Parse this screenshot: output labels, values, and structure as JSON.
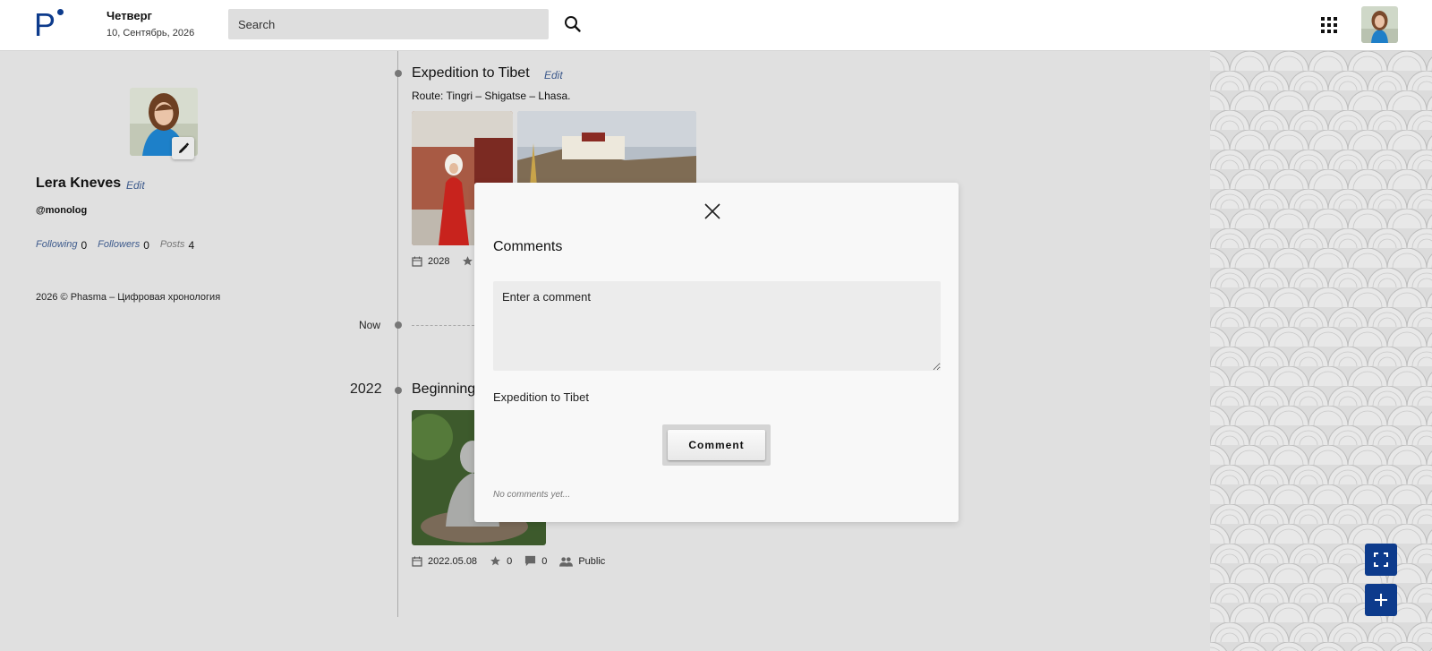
{
  "header": {
    "logo_letter": "P",
    "day_name": "Четверг",
    "date_full": "10, Сентябрь, 2026",
    "search_placeholder": "Search",
    "brand_color": "#0d3b8c"
  },
  "profile": {
    "name": "Lera Kneves",
    "edit_label": "Edit",
    "handle": "@monolog",
    "stats": [
      {
        "label": "Following",
        "value": "0"
      },
      {
        "label": "Followers",
        "value": "0"
      },
      {
        "label": "Posts",
        "value": "4"
      }
    ],
    "footer": "2026 © Phasma – Цифровая хронология"
  },
  "timeline": {
    "posts": [
      {
        "title": "Expedition to Tibet",
        "edit_label": "Edit",
        "route": "Route: Tingri – Shigatse – Lhasa.",
        "date": "2028"
      },
      {
        "title": "Beginning",
        "date": "2022.05.08",
        "stars": "0",
        "comments": "0",
        "visibility": "Public"
      }
    ],
    "now_label": "Now",
    "year_label": "2022"
  },
  "modal": {
    "title": "Comments",
    "textarea_placeholder": "Enter a comment",
    "context": "Expedition to Tibet",
    "button_label": "Comment",
    "empty_text": "No comments yet..."
  },
  "icons": {
    "search": "search-icon",
    "apps": "apps-grid-icon",
    "close": "close-icon",
    "edit": "pencil-icon",
    "calendar": "calendar-icon",
    "star": "star-icon",
    "comment": "comment-icon",
    "people": "people-icon",
    "fullscreen": "fullscreen-icon",
    "add": "plus-icon"
  }
}
